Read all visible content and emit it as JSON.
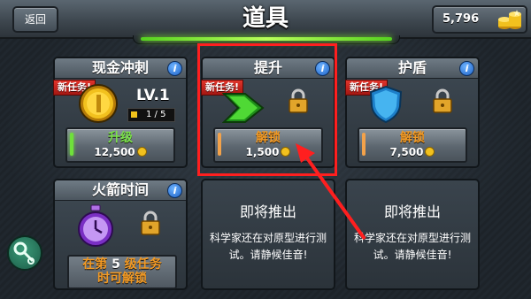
{
  "header": {
    "back_label": "返回",
    "title": "道具",
    "coins": "5,796"
  },
  "cards": {
    "cash_rush": {
      "title": "现金冲刺",
      "badge": "新任务!",
      "level": "LV.1",
      "progress": "1 / 5",
      "button_label": "升级",
      "price": "12,500",
      "button_color": "#7be24a"
    },
    "boost": {
      "title": "提升",
      "badge": "新任务!",
      "button_label": "解锁",
      "price": "1,500",
      "button_color": "#f39a24"
    },
    "shield": {
      "title": "护盾",
      "badge": "新任务!",
      "button_label": "解锁",
      "price": "7,500",
      "button_color": "#f39a24"
    },
    "rocket_time": {
      "title": "火箭时间",
      "locked_text_prefix": "在第",
      "locked_level": "5",
      "locked_text_suffix": "级任务",
      "locked_text_line2": "时可解锁"
    },
    "coming_soon_1": {
      "title": "即将推出",
      "desc": "科学家还在对原型进行测试。请静候佳音!"
    },
    "coming_soon_2": {
      "title": "即将推出",
      "desc": "科学家还在对原型进行测试。请静候佳音!"
    }
  },
  "colors": {
    "highlight": "#ff1f1f",
    "ribbon": "#c8221a",
    "unlock_text": "#f39a24",
    "upgrade_text": "#7be24a"
  }
}
